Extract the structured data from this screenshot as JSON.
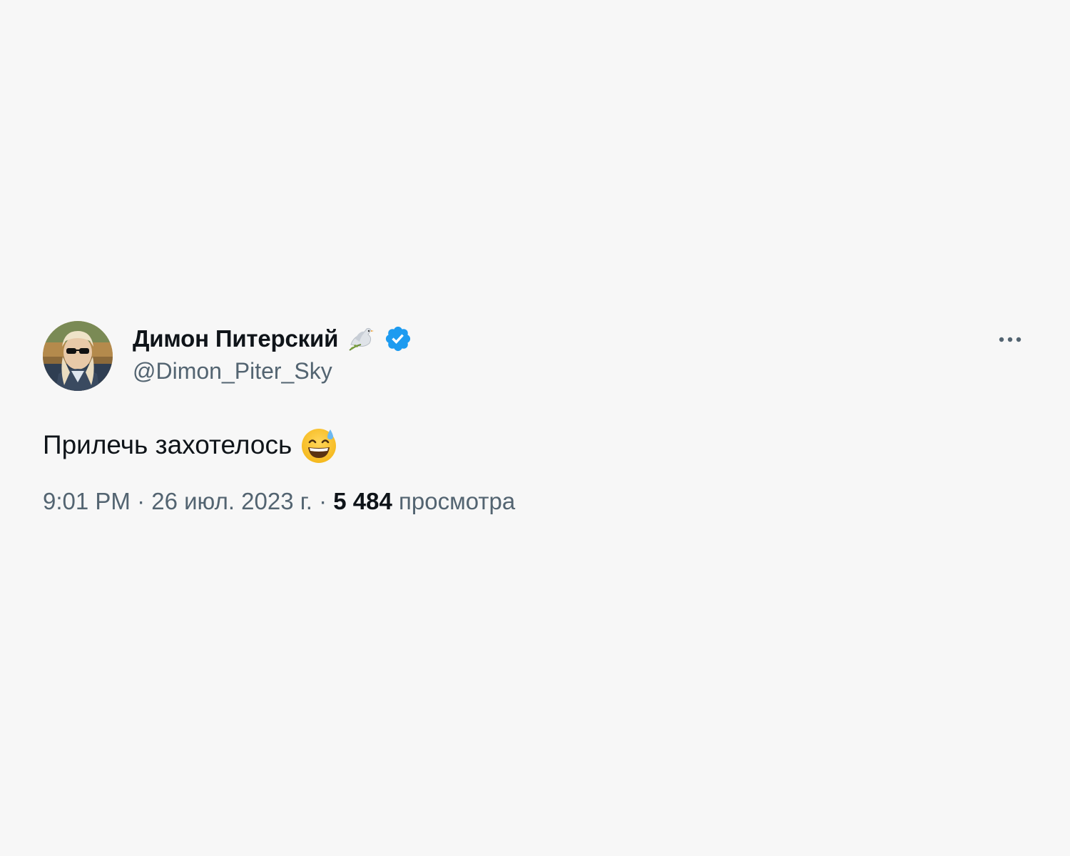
{
  "tweet": {
    "author": {
      "display_name": "Димон Питерский",
      "handle": "@Dimon_Piter_Sky",
      "avatar": "avatar-photo",
      "name_emoji": "dove-with-olive-branch-icon",
      "verified_icon": "verified-badge-icon"
    },
    "text": "Прилечь захотелось",
    "text_emoji": "grinning-face-with-sweat-icon",
    "time": "9:01 PM",
    "separator": " · ",
    "date": "26 июл. 2023 г.",
    "views_count": "5 484",
    "views_label": "просмотра"
  },
  "colors": {
    "background": "#f7f7f7",
    "primary_text": "#0f1419",
    "secondary_text": "#536471",
    "verified_blue": "#1d9bf0"
  }
}
